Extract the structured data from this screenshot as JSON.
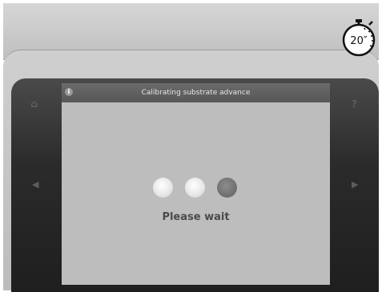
{
  "dialog": {
    "title": "Calibrating substrate advance",
    "info_icon": "i",
    "message": "Please wait",
    "progress_dots": [
      {
        "state": "inactive",
        "color": "#efefef"
      },
      {
        "state": "inactive",
        "color": "#efefef"
      },
      {
        "state": "active",
        "color": "#777777"
      }
    ]
  },
  "panel": {
    "home_icon": "⌂",
    "help_icon": "?",
    "prev_icon": "◀",
    "next_icon": "▶"
  },
  "stopwatch": {
    "label": "20″"
  },
  "colors": {
    "dialog_bg": "#bdbdbd",
    "header_bg": "#5f5f5f",
    "panel_bg": "#2b2b2b",
    "text": "#4b4b4b"
  }
}
